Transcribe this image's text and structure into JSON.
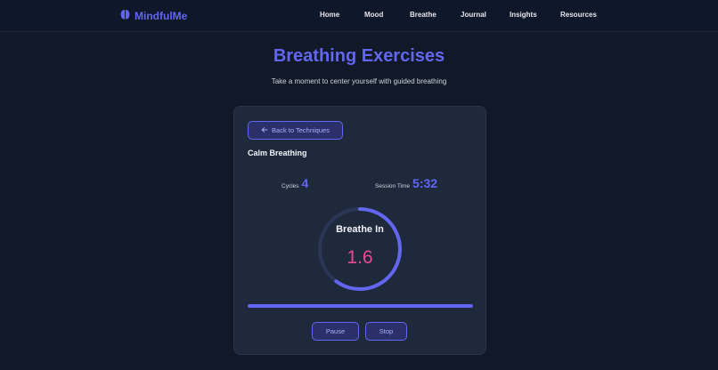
{
  "nav": {
    "brand": "MindfulMe",
    "brand_icon": "brain-icon",
    "links": [
      "Home",
      "Mood",
      "Breathe",
      "Journal",
      "Insights",
      "Resources"
    ]
  },
  "header": {
    "title": "Breathing Exercises",
    "subtitle": "Take a moment to center yourself with guided breathing"
  },
  "session": {
    "back_label": "Back to Techniques",
    "back_icon": "arrow-left-icon",
    "technique": "Calm Breathing",
    "cycles_label": "Cycles",
    "cycles_value": "4",
    "session_label": "Session Time",
    "session_value": "5:32",
    "phase": "Breathe In",
    "phase_timer": "1.6",
    "ring_progress": 0.6,
    "session_progress": 1.0,
    "pause_label": "Pause",
    "stop_label": "Stop"
  },
  "colors": {
    "accent": "#6366f1",
    "timer": "#ec4899",
    "background": "#111827",
    "card": "#1e293b"
  }
}
